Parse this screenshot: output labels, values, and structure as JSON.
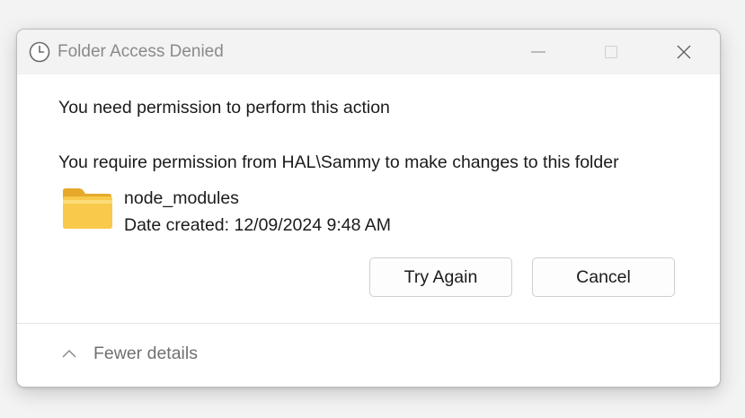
{
  "window": {
    "title": "Folder Access Denied",
    "controls": [
      "minimize",
      "maximize",
      "close"
    ]
  },
  "message": {
    "headline": "You need permission to perform this action",
    "detail": "You require permission from HAL\\Sammy to make changes to this folder"
  },
  "item": {
    "name": "node_modules",
    "date_created": "Date created: 12/09/2024 9:48 AM",
    "icon": "folder-icon"
  },
  "buttons": {
    "try_again": "Try Again",
    "cancel": "Cancel"
  },
  "footer": {
    "details_toggle": "Fewer details"
  },
  "colors": {
    "titlebar_bg": "#f3f3f3",
    "title_text": "#8a8a8a",
    "folder_yellow": "#f8c94a",
    "folder_light": "#fde28c"
  }
}
